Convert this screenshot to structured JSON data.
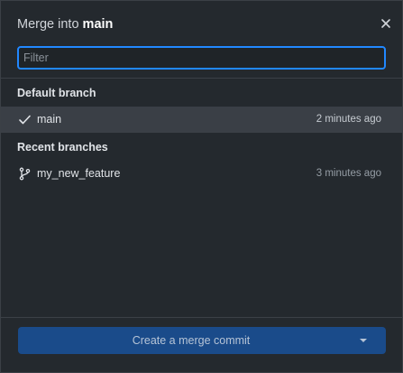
{
  "dialog": {
    "title_prefix": "Merge into ",
    "title_branch": "main",
    "close_icon": "close-icon"
  },
  "filter": {
    "placeholder": "Filter",
    "value": ""
  },
  "default_section": {
    "title": "Default branch",
    "items": [
      {
        "name": "main",
        "time": "2 minutes ago",
        "icon": "check-icon",
        "selected": true
      }
    ]
  },
  "recent_section": {
    "title": "Recent branches",
    "items": [
      {
        "name": "my_new_feature",
        "time": "3 minutes ago",
        "icon": "git-branch-icon",
        "selected": false
      }
    ]
  },
  "footer": {
    "button_label": "Create a merge commit",
    "dropdown_icon": "chevron-down-icon"
  },
  "colors": {
    "background": "#24292e",
    "focus_border": "#2188ff",
    "selected_row": "#3a3f46",
    "button": "#1a4b8a"
  }
}
